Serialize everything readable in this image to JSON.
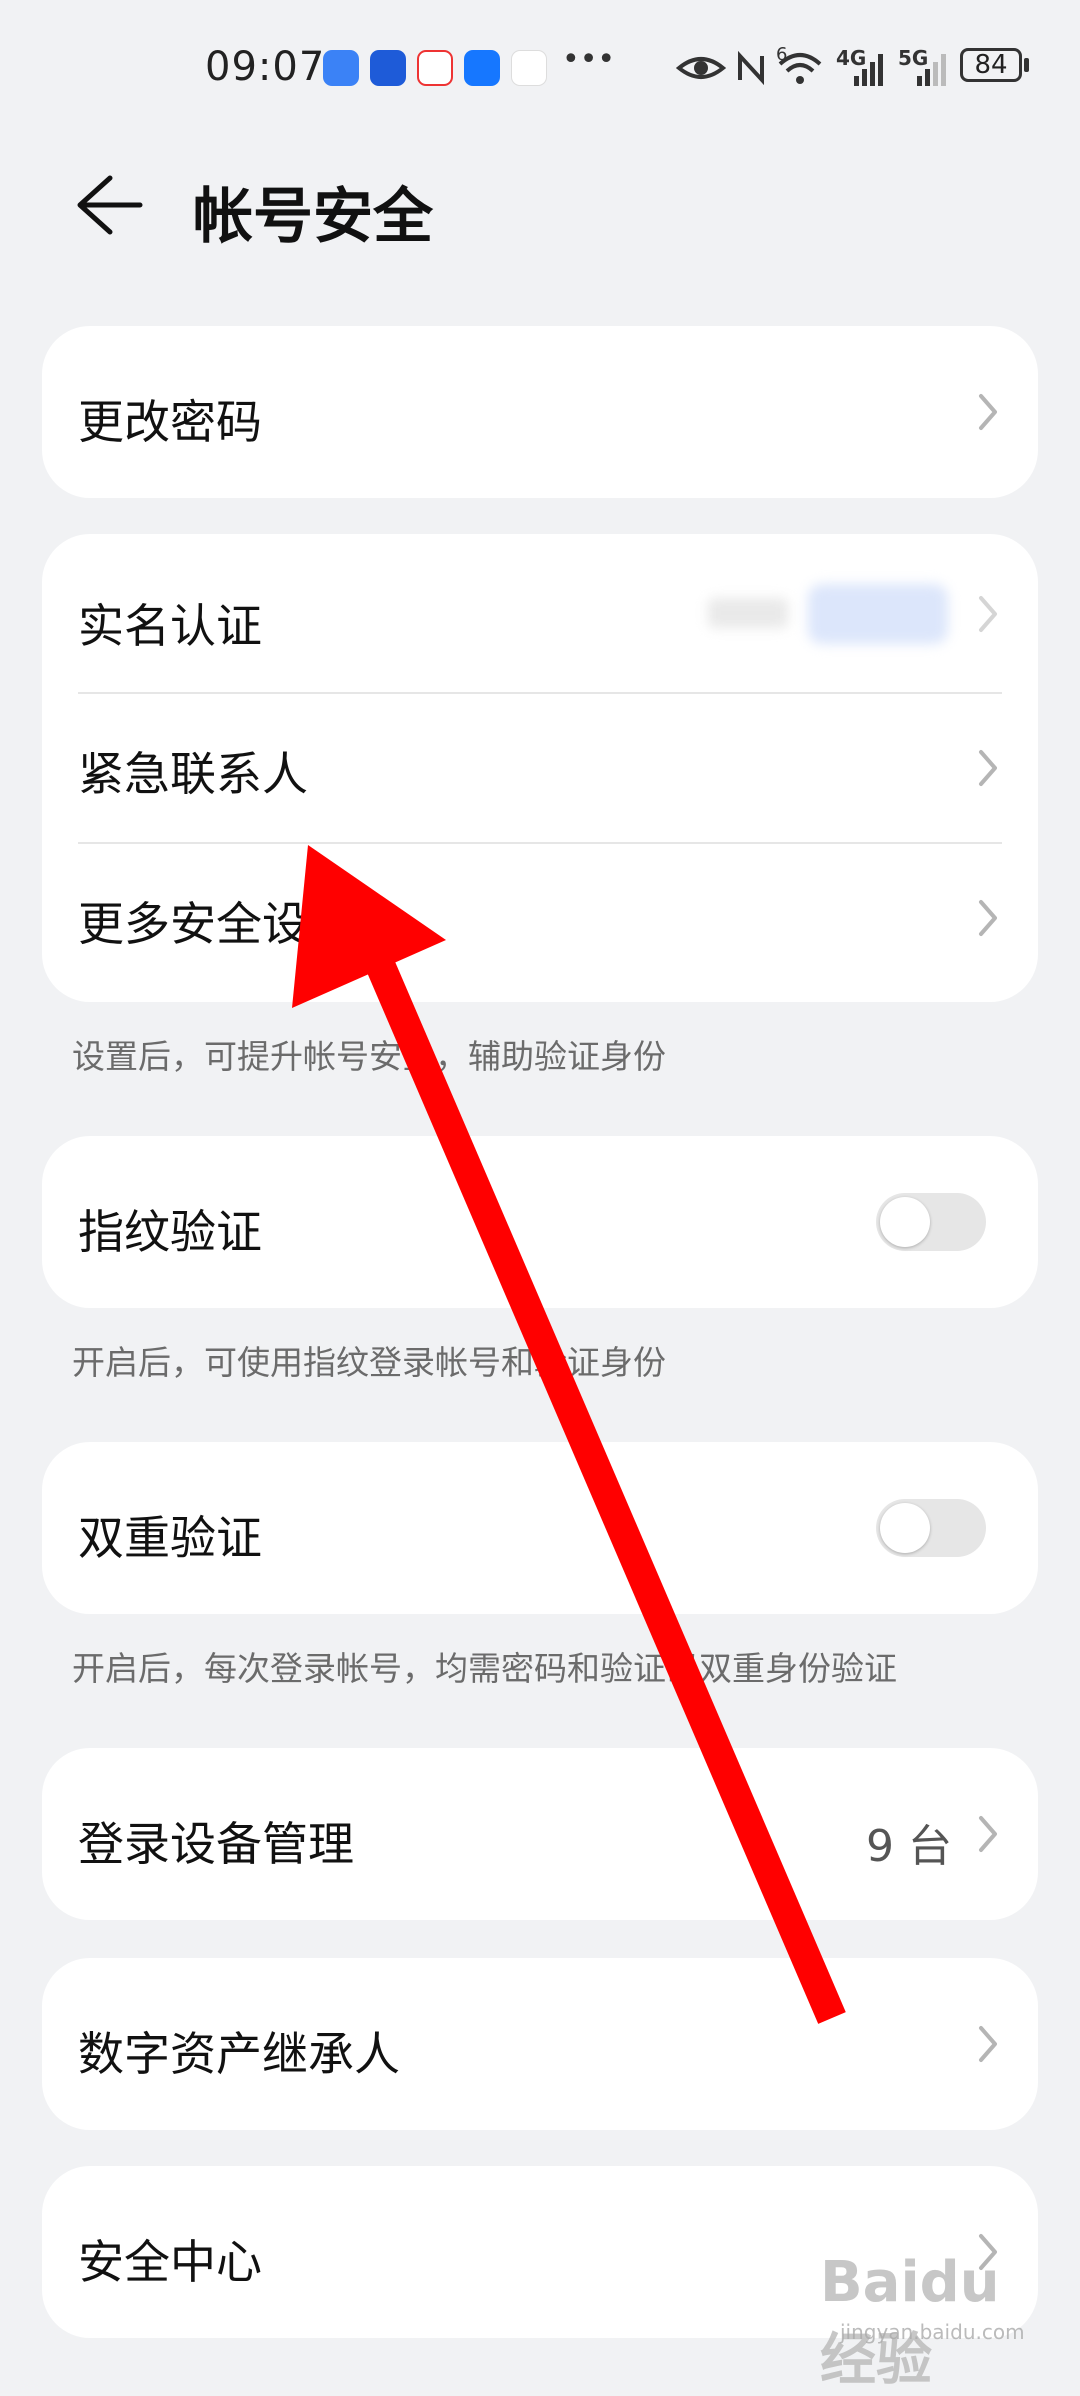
{
  "status_bar": {
    "time": "09:07",
    "battery": "84",
    "network_labels": [
      "6",
      "4G",
      "5G"
    ]
  },
  "header": {
    "title": "帐号安全",
    "back_icon": "arrow-left-icon"
  },
  "sections": {
    "change_password": "更改密码",
    "real_name": "实名认证",
    "emergency_contact": "紧急联系人",
    "more_security": "更多安全设置",
    "security_hint": "设置后，可提升帐号安全，辅助验证身份",
    "fingerprint": "指纹验证",
    "fingerprint_hint": "开启后，可使用指纹登录帐号和验证身份",
    "fingerprint_on": false,
    "two_factor": "双重验证",
    "two_factor_hint": "开启后，每次登录帐号，均需密码和验证码双重身份验证",
    "two_factor_on": false,
    "device_mgmt": "登录设备管理",
    "device_count": "9 台",
    "digital_heir": "数字资产继承人",
    "security_center": "安全中心"
  },
  "watermark": {
    "text": "Baidu经验",
    "url": "jingyan.baidu.com"
  },
  "colors": {
    "background": "#f1f2f4",
    "card": "#ffffff",
    "annotation_arrow": "#ff0000",
    "toggle_off": "#e6e6e6"
  }
}
